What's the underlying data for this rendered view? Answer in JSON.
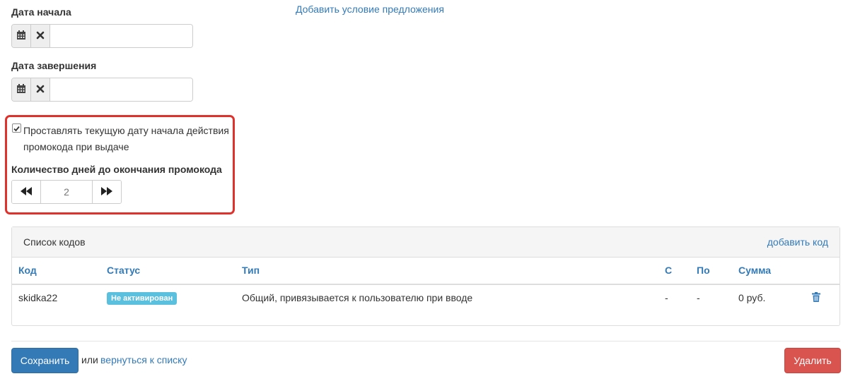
{
  "start_date": {
    "label": "Дата начала",
    "value": ""
  },
  "end_date": {
    "label": "Дата завершения",
    "value": ""
  },
  "add_condition_link": "Добавить условие предложения",
  "auto_start": {
    "checked": true,
    "label_line1": "Проставлять текущую дату начала действия",
    "label_line2": "промокода при выдаче"
  },
  "days_until_end": {
    "label": "Количество дней до окончания промокода",
    "value": "2"
  },
  "codes_panel": {
    "title": "Список кодов",
    "add_link": "добавить код",
    "columns": {
      "code": "Код",
      "status": "Статус",
      "type": "Тип",
      "from": "С",
      "to": "По",
      "sum": "Сумма"
    },
    "rows": [
      {
        "code": "skidka22",
        "status": "Не активирован",
        "type": "Общий, привязывается к пользователю при вводе",
        "from": "-",
        "to": "-",
        "sum": "0 руб."
      }
    ]
  },
  "footer": {
    "save_label": "Сохранить",
    "or_text": "или",
    "back_link": "вернуться к списку",
    "delete_label": "Удалить"
  },
  "colors": {
    "primary": "#337ab7",
    "danger": "#d9534f",
    "info": "#5bc0de",
    "highlight": "#e0322d"
  }
}
